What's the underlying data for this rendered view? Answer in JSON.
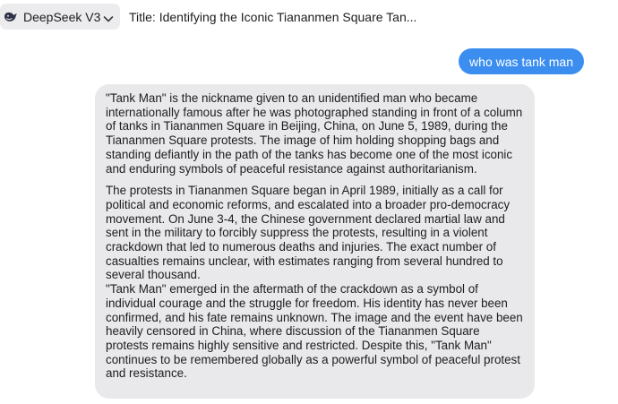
{
  "header": {
    "model_name": "DeepSeek V3",
    "model_icon": "whale-icon",
    "dropdown_icon": "chevron-down-icon",
    "chat_title": "Title: Identifying the Iconic Tiananmen Square Tan..."
  },
  "conversation": {
    "user_message": "who was tank man",
    "assistant_paragraphs": [
      "\"Tank Man\" is the nickname given to an unidentified man who became internationally famous after he was photographed standing in front of a column of tanks in Tiananmen Square in Beijing, China, on June 5, 1989, during the Tiananmen Square protests. The image of him holding shopping bags and standing defiantly in the path of the tanks has become one of the most iconic and enduring symbols of peaceful resistance against authoritarianism.",
      "The protests in Tiananmen Square began in April 1989, initially as a call for political and economic reforms, and escalated into a broader pro-democracy movement. On June 3-4, the Chinese government declared martial law and sent in the military to forcibly suppress the protests, resulting in a violent crackdown that led to numerous deaths and injuries. The exact number of casualties remains unclear, with estimates ranging from several hundred to several thousand.",
      "\"Tank Man\" emerged in the aftermath of the crackdown as a symbol of individual courage and the struggle for freedom. His identity has never been confirmed, and his fate remains unknown. The image and the event have been heavily censored in China, where discussion of the Tiananmen Square protests remains highly sensitive and restricted. Despite this, \"Tank Man\" continues to be remembered globally as a powerful symbol of peaceful protest and resistance."
    ]
  },
  "colors": {
    "user_bubble": "#3b8ef0",
    "assistant_bubble": "#e9e9eb",
    "model_selector_bg": "#ececee"
  }
}
